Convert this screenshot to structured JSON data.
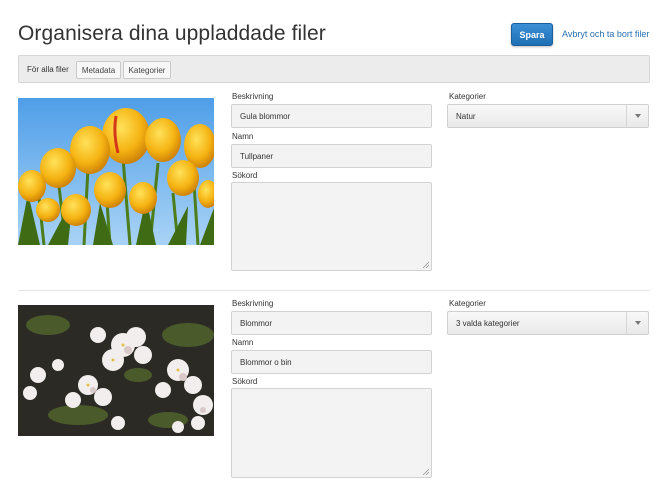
{
  "header": {
    "title": "Organisera dina uppladdade filer",
    "save_label": "Spara",
    "cancel_label": "Avbryt och ta bort filer"
  },
  "toolbar": {
    "label": "För alla filer",
    "buttons": [
      "Metadata",
      "Kategorier"
    ]
  },
  "files": [
    {
      "description_label": "Beskrivning",
      "description_value": "Gula blommor",
      "name_label": "Namn",
      "name_value": "Tullpaner",
      "keywords_label": "Sökord",
      "keywords_value": "",
      "categories_label": "Kategorier",
      "categories_value": "Natur"
    },
    {
      "description_label": "Beskrivning",
      "description_value": "Blommor",
      "name_label": "Namn",
      "name_value": "Blommor o bin",
      "keywords_label": "Sökord",
      "keywords_value": "",
      "categories_label": "Kategorier",
      "categories_value": "3 valda kategorier"
    }
  ]
}
